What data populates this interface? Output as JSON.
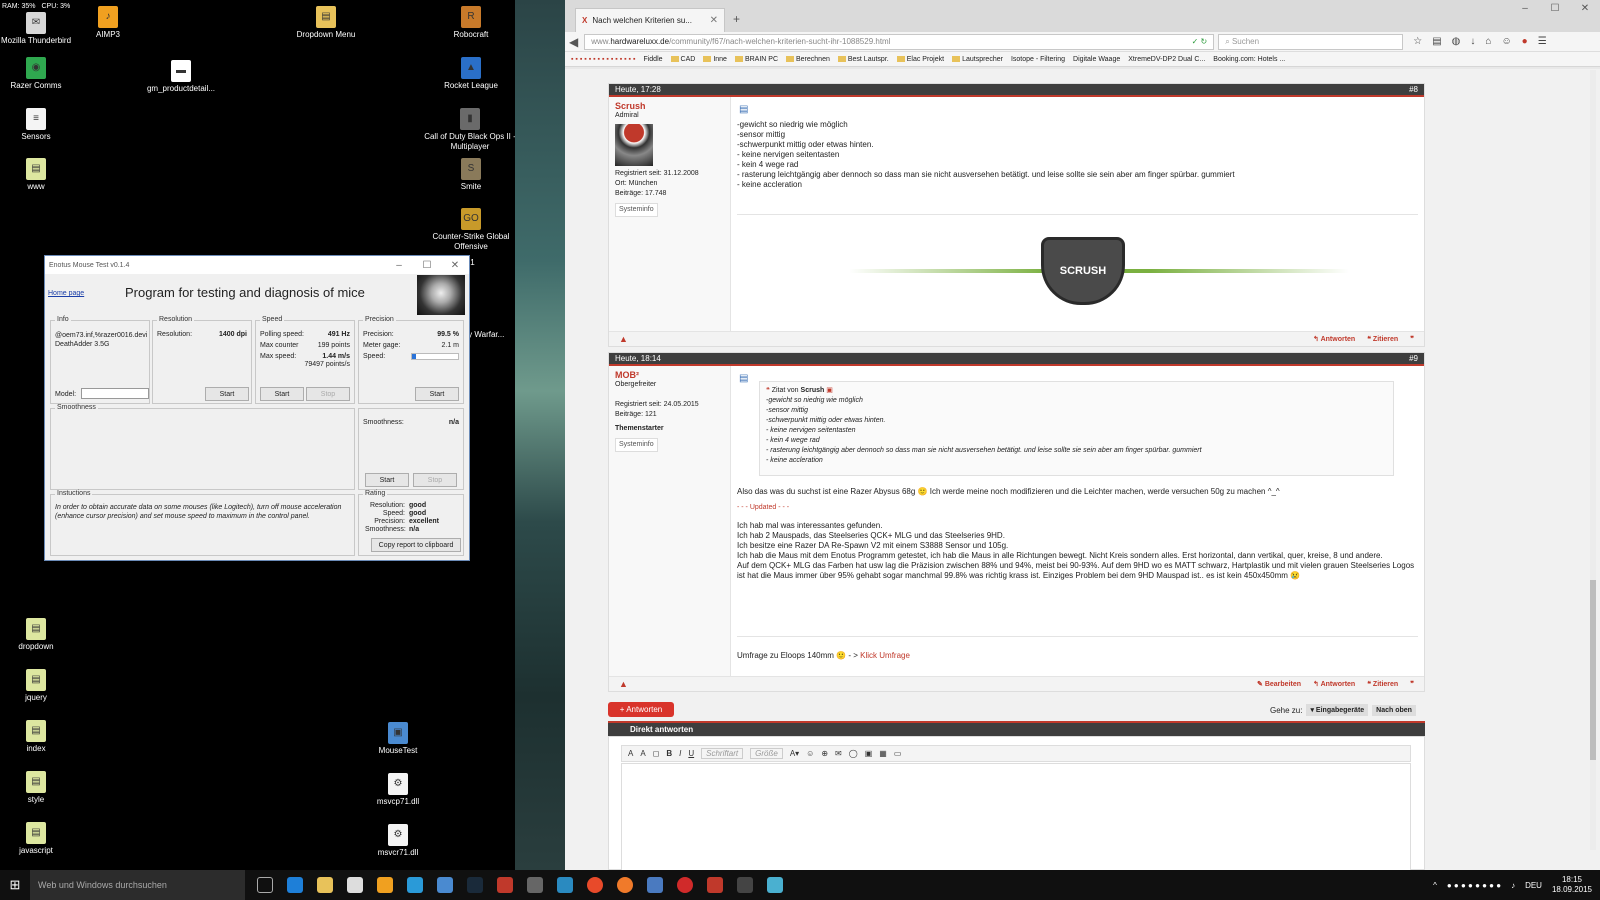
{
  "desktop": {
    "sysmon": {
      "ram": "RAM: 35%",
      "cpu": "CPU: 3%"
    },
    "icons": [
      {
        "label": "Mozilla Thunderbird",
        "icon": "thunderbird-icon"
      },
      {
        "label": "AIMP3",
        "icon": "aimp-icon"
      },
      {
        "label": "Dropdown Menu",
        "icon": "folder-icon"
      },
      {
        "label": "Robocraft",
        "icon": "robocraft-icon"
      },
      {
        "label": "Razer Comms",
        "icon": "razer-comms-icon"
      },
      {
        "label": "gm_productdetail...",
        "icon": "file-icon"
      },
      {
        "label": "Rocket League",
        "icon": "rocket-league-icon"
      },
      {
        "label": "Sensors",
        "icon": "file-icon"
      },
      {
        "label": "Call of Duty Black Ops II - Multiplayer",
        "icon": "cod-icon"
      },
      {
        "label": "www",
        "icon": "file-icon"
      },
      {
        "label": "Smite",
        "icon": "smite-icon"
      },
      {
        "label": "Counter-Strike Global Offensive",
        "icon": "csgo-icon"
      },
      {
        "label": "Z1",
        "icon": "game-icon"
      },
      {
        "label": "Duty Warfar...",
        "icon": "game-icon"
      },
      {
        "label": "dropdown",
        "icon": "file-icon"
      },
      {
        "label": "jquery",
        "icon": "file-icon"
      },
      {
        "label": "index",
        "icon": "file-icon"
      },
      {
        "label": "style",
        "icon": "file-icon"
      },
      {
        "label": "javascript",
        "icon": "file-icon"
      },
      {
        "label": "MouseTest",
        "icon": "mousetest-icon"
      },
      {
        "label": "msvcp71.dll",
        "icon": "dll-icon"
      },
      {
        "label": "msvcr71.dll",
        "icon": "dll-icon"
      }
    ]
  },
  "mousetest": {
    "title": "Enotus Mouse Test v0.1.4",
    "home": "Home page",
    "heading": "Program for testing and diagnosis of mice",
    "info": {
      "legend": "Info",
      "device": "@oem73.inf,%razer0016.devi DeathAdder 3.5G",
      "model_label": "Model:",
      "start": "Start"
    },
    "resolution": {
      "legend": "Resolution",
      "label": "Resolution:",
      "value": "1400 dpi",
      "start": "Start"
    },
    "speed": {
      "legend": "Speed",
      "polling_label": "Polling speed:",
      "polling": "491 Hz",
      "counter_label": "Max counter",
      "counter": "199 points",
      "maxspeed_label": "Max speed:",
      "maxspeed": "1.44 m/s",
      "maxspeed2": "79497 points/s",
      "start": "Start",
      "stop": "Stop"
    },
    "precision": {
      "legend": "Precision",
      "precision_label": "Precision:",
      "precision": "99.5 %",
      "meter_label": "Meter gage:",
      "meter": "2.1 m",
      "speed_label": "Speed:",
      "speed_fill": 0.08,
      "start": "Start"
    },
    "smoothness": {
      "legend": "Smoothness",
      "label": "Smoothness:",
      "value": "n/a",
      "start": "Start",
      "stop": "Stop"
    },
    "instructions": {
      "legend": "Instuctions",
      "text": "In order to obtain accurate data on some mouses (like Logitech), turn off mouse acceleration (enhance cursor precision) and set mouse speed to maximum in the control panel."
    },
    "rating": {
      "legend": "Rating",
      "res_label": "Resolution:",
      "res": "good",
      "speed_label": "Speed:",
      "speed": "good",
      "prec_label": "Precision:",
      "prec": "excellent",
      "smooth_label": "Smoothness:",
      "smooth": "n/a",
      "copy": "Copy report to clipboard"
    }
  },
  "browser": {
    "tab_title": "Nach welchen Kriterien su...",
    "url_prefix": "www.",
    "url_domain": "hardwareluxx.de",
    "url_path": "/community/f67/nach-welchen-kriterien-sucht-ihr-1088529.html",
    "search_placeholder": "Suchen",
    "bookmarks": [
      "Fiddle",
      "CAD",
      "Inne",
      "BRAIN PC",
      "Berechnen",
      "Best Lautspr.",
      "Elac Projekt",
      "Lautsprecher",
      "Isotope - Filtering",
      "Digitale Waage",
      "XtremeDV-DP2 Dual C...",
      "Booking.com: Hotels ..."
    ]
  },
  "posts": [
    {
      "date": "Heute, 17:28",
      "number": "#8",
      "user": "Scrush",
      "rank": "Admiral",
      "registered": "Registriert seit: 31.12.2008",
      "location": "Ort: München",
      "posts": "Beiträge: 17.748",
      "sysinfo": "Systeminfo",
      "lines": [
        "-gewicht so niedrig wie möglich",
        "-sensor mittig",
        "-schwerpunkt mittig oder etwas hinten.",
        " - keine nervigen seitentasten",
        " - kein 4 wege rad",
        " - rasterung leichtgängig aber dennoch so dass man sie nicht ausversehen betätigt. und leise sollte sie sein aber am finger spürbar. gummiert",
        " - keine accleration"
      ],
      "signature": "SCRUSH",
      "reply": "Antworten",
      "quote": "Zitieren"
    },
    {
      "date": "Heute, 18:14",
      "number": "#9",
      "user": "MOB²",
      "rank": "Obergefreiter",
      "registered": "Registriert seit: 24.05.2015",
      "posts": "Beiträge: 121",
      "starter": "Themenstarter",
      "sysinfo": "Systeminfo",
      "quote_from": "Zitat von",
      "quote_user": "Scrush",
      "quote_lines": [
        "-gewicht so niedrig wie möglich",
        "-sensor mittig",
        "-schwerpunkt mittig oder etwas hinten.",
        "- keine nervigen seitentasten",
        "- kein 4 wege rad",
        "- rasterung leichtgängig aber dennoch so dass man sie nicht ausversehen betätigt. und leise sollte sie sein aber am finger spürbar. gummiert",
        "- keine accleration"
      ],
      "text1": "Also das was du suchst ist eine Razer Abysus 68g 🙂 Ich werde meine noch modifizieren und die Leichter machen, werde versuchen 50g zu machen ^_^",
      "updated": "- - - Updated - - -",
      "text2": [
        "Ich hab mal was interessantes gefunden.",
        "Ich hab 2 Mauspads, das Steelseries QCK+ MLG und das Steelseries 9HD.",
        "Ich besitze eine Razer DA Re-Spawn V2 mit einem S3888 Sensor und 105g.",
        "Ich hab die Maus mit dem Enotus Programm getestet, ich hab die Maus in alle Richtungen bewegt. Nicht Kreis sondern alles. Erst horizontal, dann vertikal, quer, kreise, 8 und andere.",
        "Auf dem QCK+ MLG das Farben hat usw lag die Präzision zwischen 88% und 94%, meist bei 90-93%. Auf dem 9HD wo es MATT schwarz, Hartplastik und mit vielen grauen Steelseries Logos ist hat die Maus immer über 95% gehabt sogar manchmal 99.8% was richtig krass ist. Einziges Problem bei dem 9HD Mauspad ist.. es ist kein 450x450mm 😢"
      ],
      "poll_text": "Umfrage zu Eloops 140mm 🙂 - >",
      "poll_link": "Klick Umfrage",
      "edit": "Bearbeiten",
      "reply": "Antworten",
      "quote": "Zitieren"
    }
  ],
  "reply_button": "+ Antworten",
  "goto": {
    "label": "Gehe zu:",
    "received": "▾ Eingabegeräte",
    "top": "Nach oben"
  },
  "direct_reply": "Direkt antworten",
  "editor": {
    "font": "Schriftart",
    "size": "Größe"
  },
  "taskbar": {
    "search": "Web und Windows durchsuchen",
    "lang": "DEU",
    "time": "18:15",
    "date": "18.09.2015"
  }
}
